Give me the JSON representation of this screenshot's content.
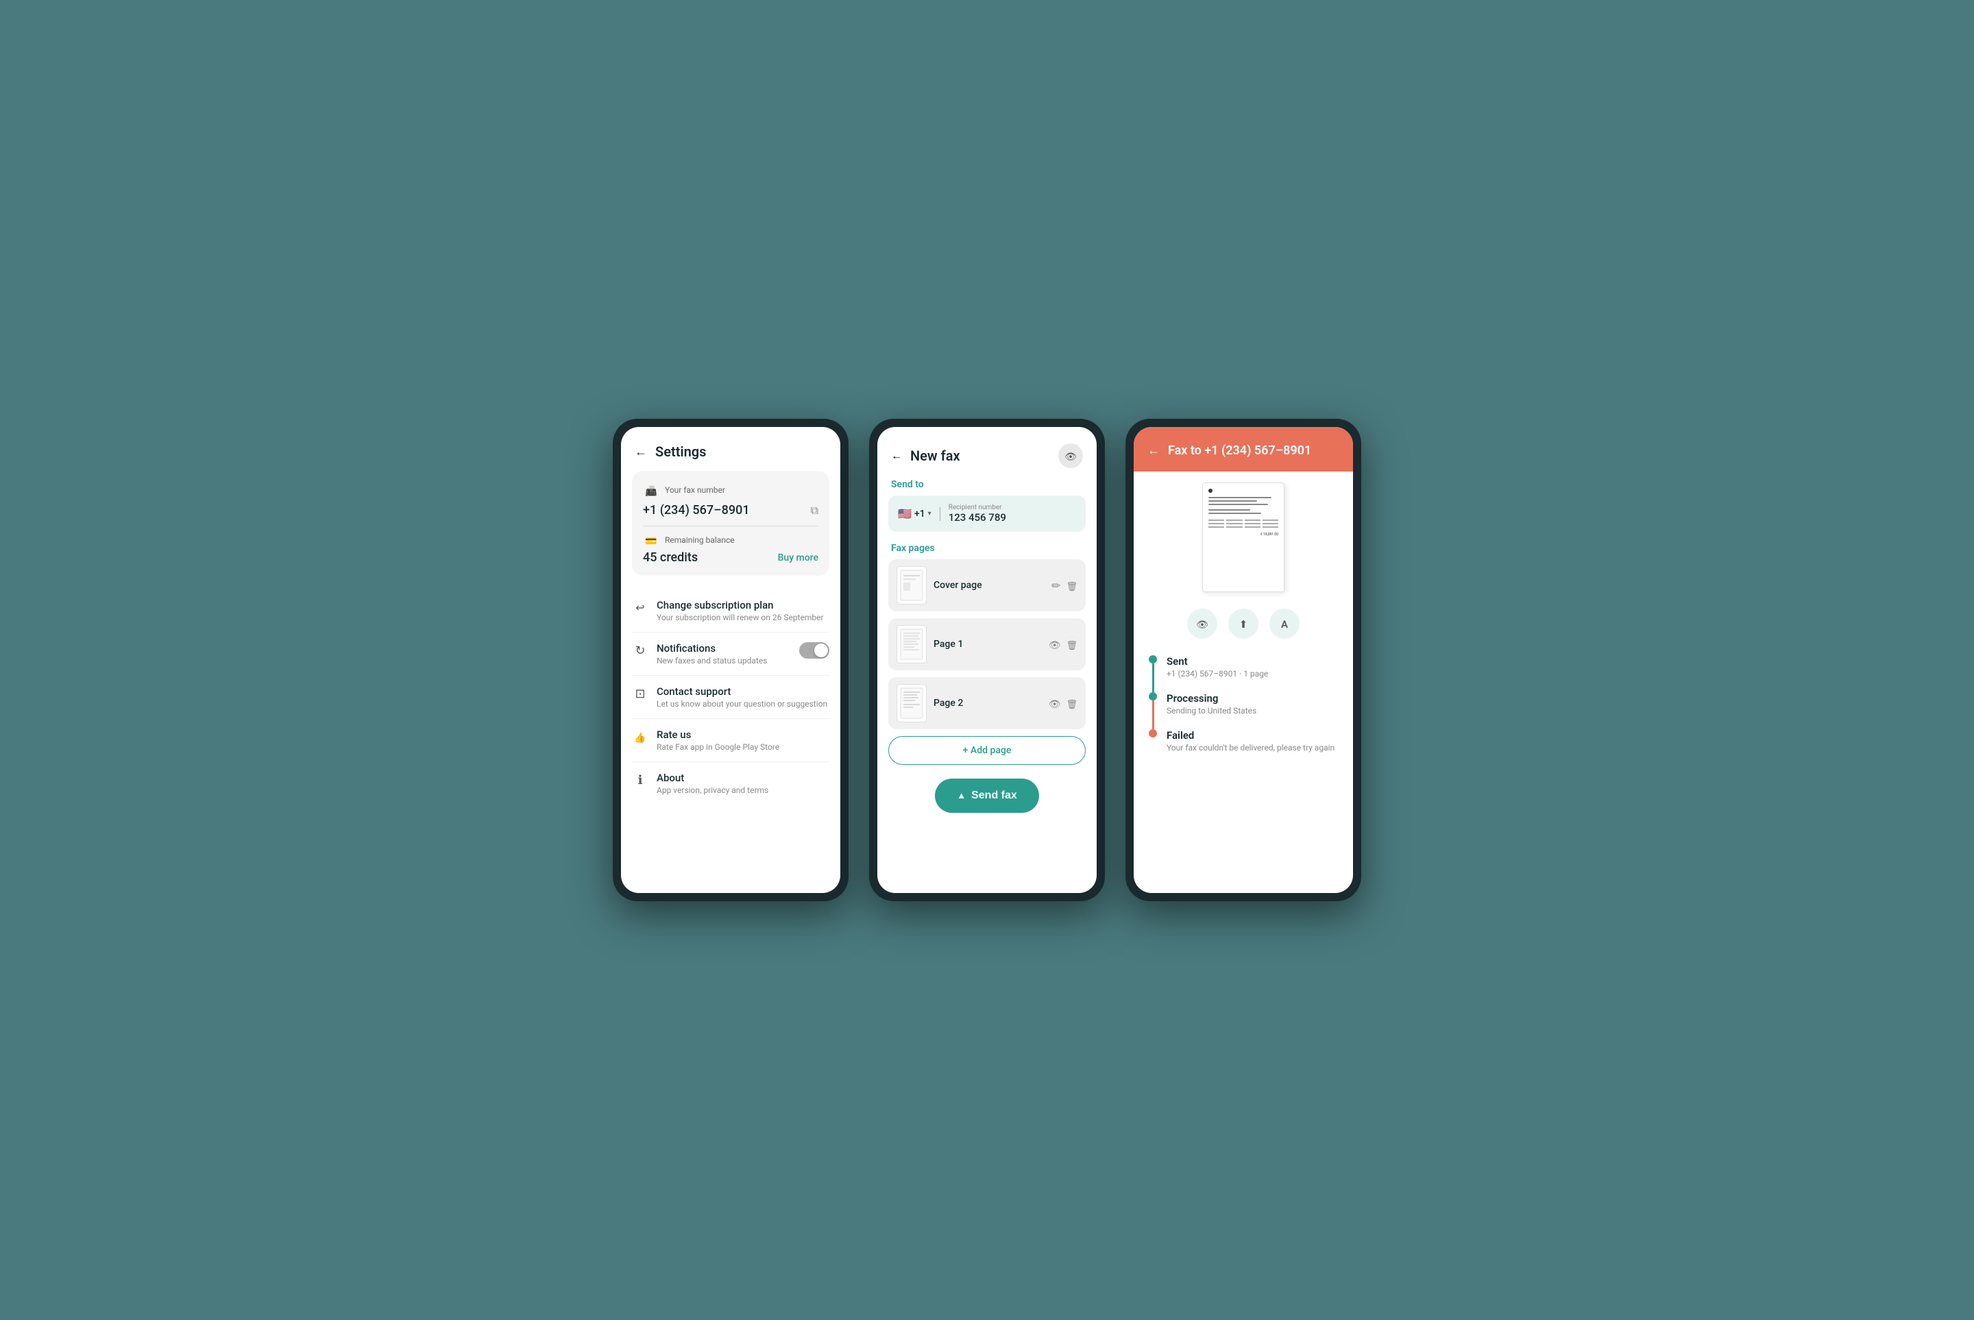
{
  "screen1": {
    "header": {
      "back_label": "←",
      "title": "Settings"
    },
    "fax_card": {
      "fax_number_label": "Your fax number",
      "fax_number": "+1 (234) 567–8901",
      "balance_label": "Remaining balance",
      "balance_amount": "45 credits",
      "buy_more_label": "Buy more"
    },
    "menu_items": [
      {
        "icon": "subscription-icon",
        "title": "Change subscription plan",
        "subtitle": "Your subscription will renew on 26 September"
      },
      {
        "icon": "notifications-icon",
        "title": "Notifications",
        "subtitle": "New faxes and status updates",
        "has_toggle": true
      },
      {
        "icon": "support-icon",
        "title": "Contact support",
        "subtitle": "Let us know about your question or suggestion"
      },
      {
        "icon": "rate-icon",
        "title": "Rate us",
        "subtitle": "Rate Fax app in Google Play Store"
      },
      {
        "icon": "about-icon",
        "title": "About",
        "subtitle": "App version, privacy and terms"
      }
    ]
  },
  "screen2": {
    "header": {
      "back_label": "←",
      "title": "New fax"
    },
    "send_to_label": "Send to",
    "recipient": {
      "flag": "🇺🇸",
      "country_code": "+1",
      "number_label": "Recipient number",
      "number": "123 456 789"
    },
    "fax_pages_label": "Fax pages",
    "pages": [
      {
        "name": "Cover page",
        "has_edit": true,
        "has_delete": true
      },
      {
        "name": "Page 1",
        "has_eye": true,
        "has_delete": true
      },
      {
        "name": "Page 2",
        "has_eye": true,
        "has_delete": true
      }
    ],
    "add_page_label": "+ Add page",
    "send_button_label": "Send fax"
  },
  "screen3": {
    "header": {
      "back_label": "←",
      "title": "Fax to +1 (234) 567–8901"
    },
    "preview_amount": "€ 18,081.00",
    "action_icons": [
      "eye",
      "share",
      "font"
    ],
    "status_steps": [
      {
        "dot_color": "green",
        "line_color": "green",
        "title": "Sent",
        "subtitle": "+1 (234) 567–8901 · 1 page"
      },
      {
        "dot_color": "green",
        "line_color": "red",
        "title": "Processing",
        "subtitle": "Sending to United States"
      },
      {
        "dot_color": "red",
        "line_color": null,
        "title": "Failed",
        "subtitle": "Your fax couldn't be delivered, please try again"
      }
    ]
  }
}
